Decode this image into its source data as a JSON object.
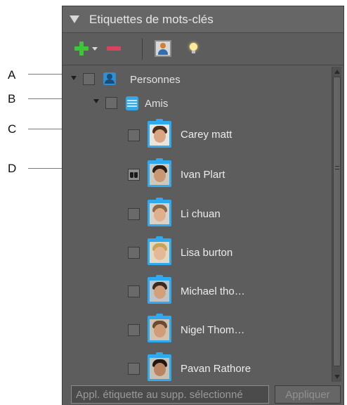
{
  "callouts": [
    "A",
    "B",
    "C",
    "D"
  ],
  "panel": {
    "title": "Etiquettes de mots-clés"
  },
  "toolbar": {
    "icons": [
      "plus-icon",
      "dropdown-arrow-icon",
      "minus-icon",
      "person-tag-icon",
      "lightbulb-icon"
    ],
    "colors": {
      "plus": "#3ec63a",
      "minus": "#d9445c"
    }
  },
  "tree": {
    "category": {
      "label": "Personnes",
      "icon": "person-category-icon"
    },
    "subcategory": {
      "label": "Amis",
      "icon": "tag-icon"
    },
    "people": [
      {
        "name": "Carey matt",
        "state": "unchecked"
      },
      {
        "name": "Ivan Plart",
        "state": "binoculars"
      },
      {
        "name": "Li chuan",
        "state": "unchecked"
      },
      {
        "name": "Lisa burton",
        "state": "unchecked"
      },
      {
        "name": "Michael tho…",
        "state": "unchecked"
      },
      {
        "name": "Nigel Thom…",
        "state": "unchecked"
      },
      {
        "name": "Pavan Rathore",
        "state": "unchecked"
      }
    ]
  },
  "footer": {
    "apply_field_value": "Appl. étiquette au supp. sélectionné",
    "apply_button": "Appliquer"
  }
}
